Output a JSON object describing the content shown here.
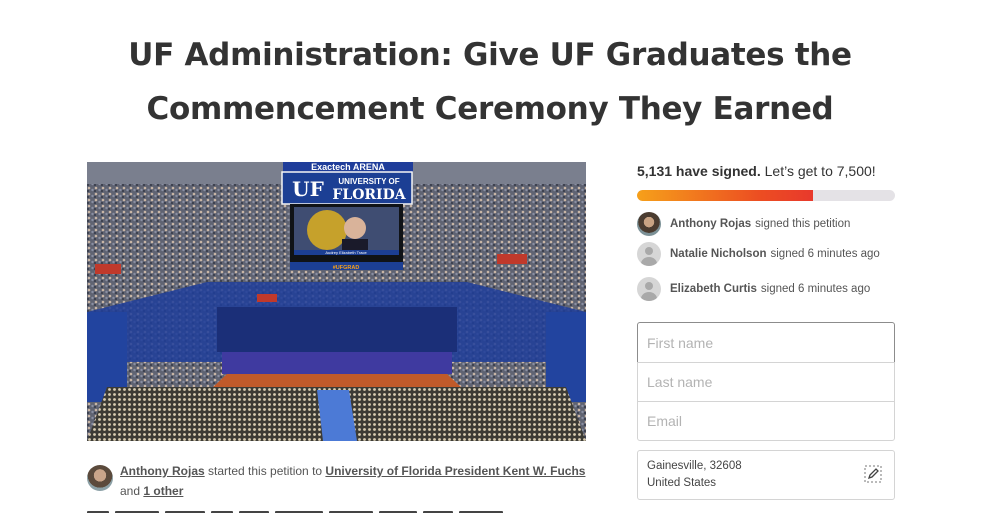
{
  "title": {
    "line1": "UF Administration: Give UF Graduates the",
    "line2": "Commencement Ceremony They Earned"
  },
  "hero": {
    "alt": "Graduation ceremony inside Exactech Arena",
    "scoreboard_top": "Exactech ARENA",
    "scoreboard_brand_uf": "UF",
    "scoreboard_brand_text1": "UNIVERSITY OF",
    "scoreboard_brand_text2": "FLORIDA",
    "screen_caption": "Audrey Elizabeth Trace",
    "screen_hashtag": "#UFGRAD"
  },
  "starter": {
    "name": "Anthony Rojas",
    "verb": " started this petition to ",
    "target": "University of Florida President Kent W. Fuchs",
    "and": " and ",
    "other": "1 other"
  },
  "progress": {
    "count": "5,131 have signed.",
    "goal": " Let’s get to 7,500!",
    "fraction": 0.684
  },
  "signers": [
    {
      "name": "Anthony Rojas",
      "action": "signed this petition",
      "avatar": "photo"
    },
    {
      "name": "Natalie Nicholson",
      "action": "signed 6 minutes ago",
      "avatar": "default-avatar-icon"
    },
    {
      "name": "Elizabeth Curtis",
      "action": "signed 6 minutes ago",
      "avatar": "default-avatar-icon"
    }
  ],
  "form": {
    "first_name_placeholder": "First name",
    "last_name_placeholder": "Last name",
    "email_placeholder": "Email",
    "location_line1": "Gainesville, 32608",
    "location_line2": "United States"
  },
  "colors": {
    "progress_start": "#f6a01a",
    "progress_end": "#e8392c",
    "progress_track": "#e4e2e6",
    "scoreboard_blue": "#1c3f94"
  }
}
